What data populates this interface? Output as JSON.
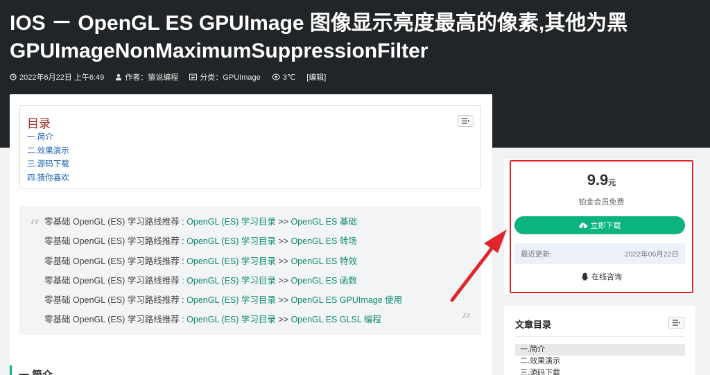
{
  "post": {
    "title_line1": "IOS  －  OpenGL ES GPUImage 图像显示亮度最高的像素,其他为黑",
    "title_line2": "GPUImageNonMaximumSuppressionFilter",
    "meta": {
      "date": "2022年6月22日 上午6:49",
      "author": "作者：猿说编程",
      "category": "分类：GPUImage",
      "views": "3℃",
      "edit": "[编辑]"
    }
  },
  "toc": {
    "title": "目录",
    "items": [
      "一.简介",
      "二.效果演示",
      "三.源码下载",
      "四.猜你喜欢"
    ]
  },
  "quote": {
    "open_mark": "“",
    "close_mark": "”",
    "lines": [
      {
        "prefix": "零基础 OpenGL (ES) 学习路线推荐 : ",
        "link1": "OpenGL (ES) 学习目录",
        "sep": " >> ",
        "link2": "OpenGL ES 基础"
      },
      {
        "prefix": "零基础 OpenGL (ES) 学习路线推荐 : ",
        "link1": "OpenGL (ES) 学习目录",
        "sep": " >> ",
        "link2": "OpenGL ES 转场"
      },
      {
        "prefix": "零基础 OpenGL (ES) 学习路线推荐 : ",
        "link1": "OpenGL (ES) 学习目录",
        "sep": " >> ",
        "link2": "OpenGL ES 特效"
      },
      {
        "prefix": "零基础 OpenGL (ES) 学习路线推荐 : ",
        "link1": "OpenGL (ES) 学习目录",
        "sep": " >> ",
        "link2": "OpenGL ES 函数"
      },
      {
        "prefix": "零基础 OpenGL (ES) 学习路线推荐 : ",
        "link1": "OpenGL (ES) 学习目录",
        "sep": " >> ",
        "link2": "OpenGL ES GPUImage 使用"
      },
      {
        "prefix": "零基础 OpenGL (ES) 学习路线推荐 : ",
        "link1": "OpenGL (ES) 学习目录",
        "sep": " >> ",
        "link2": "OpenGL ES GLSL 编程"
      }
    ]
  },
  "section": {
    "heading": "一.简介"
  },
  "download": {
    "price": "9.9",
    "unit": "元",
    "vip_note": "铂金会员免费",
    "button_label": "立即下载",
    "updated_label": "最近更新:",
    "updated_date": "2022年06月22日",
    "consult_label": "在线咨询"
  },
  "article_toc": {
    "title": "文章目录",
    "items": [
      "一.简介",
      "二.效果演示",
      "三.源码下载"
    ]
  },
  "colors": {
    "accent": "#0bb37f",
    "link": "#0f8a72",
    "highlight": "#e0262a",
    "header_bg": "#222527"
  }
}
